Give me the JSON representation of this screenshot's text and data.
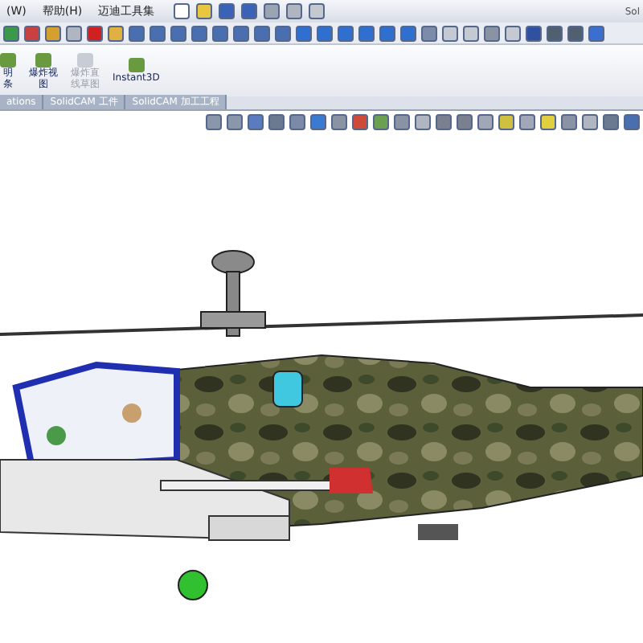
{
  "menu_bar": {
    "items": [
      "(W)",
      "帮助(H)",
      "迈迪工具集"
    ],
    "title": "Sol"
  },
  "ribbon": {
    "buttons": [
      {
        "lines": [
          "明",
          "条"
        ],
        "disabled": false
      },
      {
        "lines": [
          "爆炸视",
          "图"
        ],
        "disabled": false
      },
      {
        "lines": [
          "爆炸直",
          "线草图"
        ],
        "disabled": true
      },
      {
        "lines": [
          "Instant3D"
        ],
        "disabled": false
      }
    ]
  },
  "tabs": [
    {
      "label": "ations",
      "selected": false
    },
    {
      "label": "SolidCAM 工件",
      "selected": false
    },
    {
      "label": "SolidCAM 加工工程",
      "selected": false
    }
  ]
}
